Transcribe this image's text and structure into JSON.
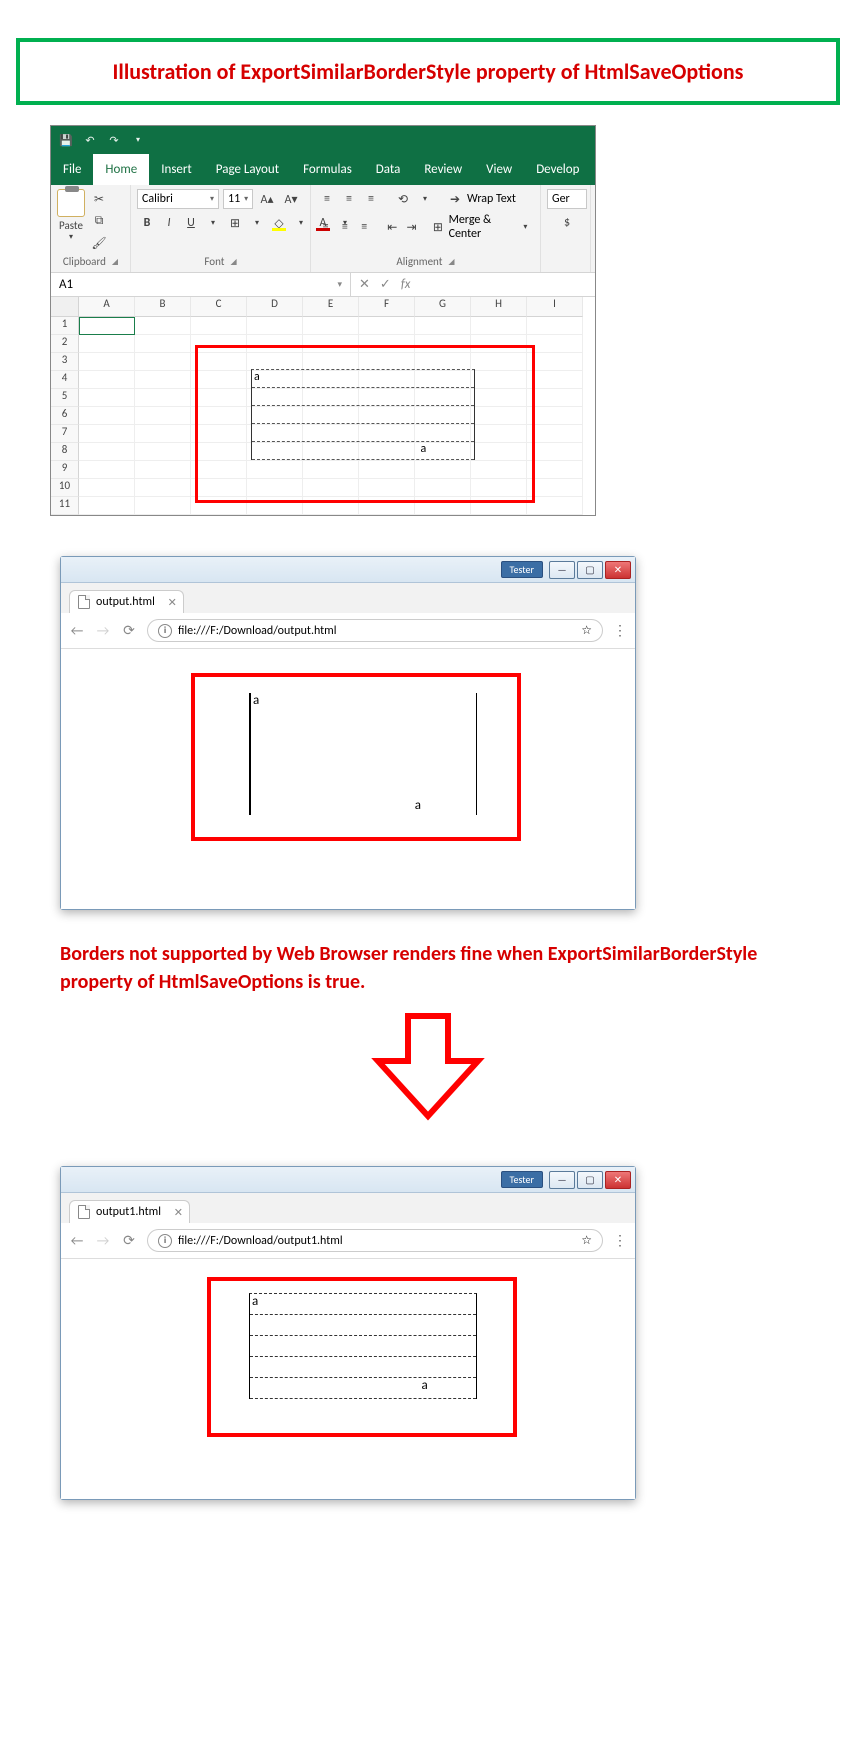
{
  "title_box": "Illustration of ExportSimilarBorderStyle property of HtmlSaveOptions",
  "excel": {
    "tabs": [
      "File",
      "Home",
      "Insert",
      "Page Layout",
      "Formulas",
      "Data",
      "Review",
      "View",
      "Develop"
    ],
    "active_tab": "Home",
    "paste_label": "Paste",
    "clipboard_label": "Clipboard",
    "font": {
      "name": "Calibri",
      "size": "11",
      "bold": "B",
      "italic": "I",
      "underline": "U",
      "label": "Font"
    },
    "alignment": {
      "wrap": "Wrap Text",
      "merge": "Merge & Center",
      "label": "Alignment"
    },
    "number": {
      "format": "Ger",
      "currency": "$"
    },
    "name_box": "A1",
    "fx": "fx",
    "cols": [
      "A",
      "B",
      "C",
      "D",
      "E",
      "F",
      "G",
      "H",
      "I"
    ],
    "rows": [
      "1",
      "2",
      "3",
      "4",
      "5",
      "6",
      "7",
      "8",
      "9",
      "10",
      "11"
    ],
    "cell_a": "a",
    "cell_b": "a"
  },
  "browser1": {
    "tester": "Tester",
    "tab_title": "output.html",
    "url": "file:///F:/Download/output.html",
    "cell_a": "a",
    "cell_b": "a"
  },
  "caption": "Borders not supported by Web Browser renders fine when ExportSimilarBorderStyle property of HtmlSaveOptions is true.",
  "browser2": {
    "tester": "Tester",
    "tab_title": "output1.html",
    "url": "file:///F:/Download/output1.html",
    "cell_a": "a",
    "cell_b": "a"
  }
}
